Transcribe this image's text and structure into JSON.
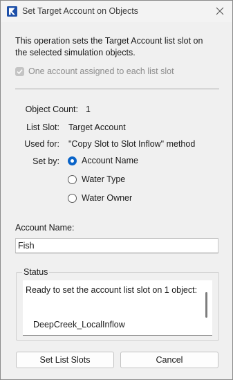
{
  "window": {
    "title": "Set Target Account on Objects",
    "accent_color": "#0a64c8"
  },
  "intro": {
    "text": "This operation sets the Target Account list slot on the selected simulation objects."
  },
  "checkbox": {
    "label": "One account assigned to each list slot",
    "checked": true,
    "enabled": false
  },
  "details": {
    "object_count_label": "Object Count:",
    "object_count_value": "1",
    "list_slot_label": "List Slot:",
    "list_slot_value": "Target Account",
    "used_for_label": "Used for:",
    "used_for_value": "\"Copy Slot to Slot Inflow\" method",
    "set_by_label": "Set by:"
  },
  "set_by_options": [
    {
      "label": "Account Name",
      "selected": true
    },
    {
      "label": "Water Type",
      "selected": false
    },
    {
      "label": "Water Owner",
      "selected": false
    }
  ],
  "account_name": {
    "label": "Account Name:",
    "value": "Fish"
  },
  "status": {
    "title": "Status",
    "message": "Ready to set the account list slot on 1 object:",
    "object": "DeepCreek_LocalInflow"
  },
  "buttons": {
    "set_list_slots": "Set List Slots",
    "cancel": "Cancel"
  }
}
